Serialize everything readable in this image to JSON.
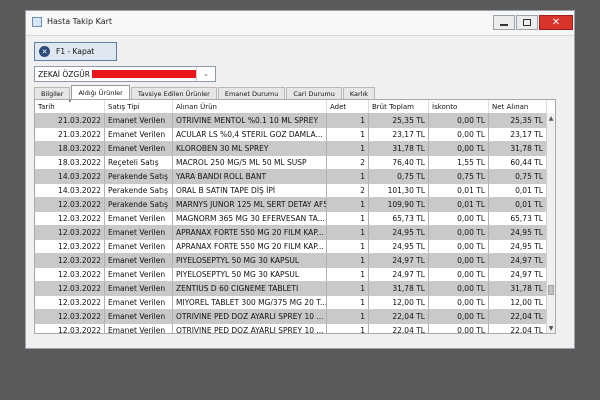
{
  "window": {
    "title": "Hasta Takip Kart"
  },
  "toolbar": {
    "close_label": "F1 - Kapat"
  },
  "patient": {
    "name": "ZEKAİ ÖZGÜR"
  },
  "tabs": [
    {
      "label": "Bilgiler"
    },
    {
      "label": "Aldığı Ürünler"
    },
    {
      "label": "Tavsiye Edilen Ürünler"
    },
    {
      "label": "Emanet Durumu"
    },
    {
      "label": "Cari Durumu"
    },
    {
      "label": "Karlık"
    }
  ],
  "table": {
    "headers": [
      "Tarih",
      "Satış Tipi",
      "Alınan Ürün",
      "Adet",
      "Brüt Toplam",
      "İskonto",
      "Net Alınan"
    ],
    "rows": [
      [
        "21.03.2022",
        "Emanet Verilen",
        "OTRIVINE MENTOL %0.1  10 ML SPREY",
        "1",
        "25,35 TL",
        "0,00 TL",
        "25,35 TL"
      ],
      [
        "21.03.2022",
        "Emanet Verilen",
        "ACULAR LS  %0,4 STERIL GOZ DAMLA...",
        "1",
        "23,17 TL",
        "0,00 TL",
        "23,17 TL"
      ],
      [
        "18.03.2022",
        "Emanet Verilen",
        "KLOROBEN 30 ML SPREY",
        "1",
        "31,78 TL",
        "0,00 TL",
        "31,78 TL"
      ],
      [
        "18.03.2022",
        "Reçeteli Satış",
        "MACROL 250 MG/5 ML 50 ML SUSP",
        "2",
        "76,40 TL",
        "1,55 TL",
        "60,44 TL"
      ],
      [
        "14.03.2022",
        "Perakende Satış",
        "YARA BANDI ROLL BANT",
        "1",
        "0,75 TL",
        "0,75 TL",
        "0,75 TL"
      ],
      [
        "14.03.2022",
        "Perakende Satış",
        "ORAL B SATIN TAPE DİŞ İPİ",
        "2",
        "101,30 TL",
        "0,01 TL",
        "0,01 TL"
      ],
      [
        "12.03.2022",
        "Perakende Satış",
        "MARNYS JUNOR 125 ML SERT DETAY AF5...",
        "1",
        "109,90 TL",
        "0,01 TL",
        "0,01 TL"
      ],
      [
        "12.03.2022",
        "Emanet Verilen",
        "MAGNORM 365 MG 30 EFERVESAN TA...",
        "1",
        "65,73 TL",
        "0,00 TL",
        "65,73 TL"
      ],
      [
        "12.03.2022",
        "Emanet Verilen",
        "APRANAX FORTE 550 MG 20 FILM KAP...",
        "1",
        "24,95 TL",
        "0,00 TL",
        "24,95 TL"
      ],
      [
        "12.03.2022",
        "Emanet Verilen",
        "APRANAX FORTE 550 MG 20 FILM KAP...",
        "1",
        "24,95 TL",
        "0,00 TL",
        "24,95 TL"
      ],
      [
        "12.03.2022",
        "Emanet Verilen",
        "PIYELOSEPTYL 50 MG 30 KAPSUL",
        "1",
        "24,97 TL",
        "0,00 TL",
        "24,97 TL"
      ],
      [
        "12.03.2022",
        "Emanet Verilen",
        "PIYELOSEPTYL 50 MG 30 KAPSUL",
        "1",
        "24,97 TL",
        "0,00 TL",
        "24,97 TL"
      ],
      [
        "12.03.2022",
        "Emanet Verilen",
        "ZENTIUS D 60 CIGNEME TABLETI",
        "1",
        "31,78 TL",
        "0,00 TL",
        "31,78 TL"
      ],
      [
        "12.03.2022",
        "Emanet Verilen",
        "MIYOREL TABLET 300 MG/375 MG 20 T...",
        "1",
        "12,00 TL",
        "0,00 TL",
        "12,00 TL"
      ],
      [
        "12.03.2022",
        "Emanet Verilen",
        "OTRIVINE PED DOZ AYARLI SPREY 10 ...",
        "1",
        "22,04 TL",
        "0,00 TL",
        "22,04 TL"
      ],
      [
        "12.03.2022",
        "Emanet Verilen",
        "OTRIVINE PED DOZ AYARLI SPREY 10 ...",
        "1",
        "22,04 TL",
        "0,00 TL",
        "22,04 TL"
      ]
    ]
  },
  "colors": {
    "redaction": "#e8161b",
    "row_alt": "#c9c9c9",
    "close_button": "#d9342b"
  }
}
